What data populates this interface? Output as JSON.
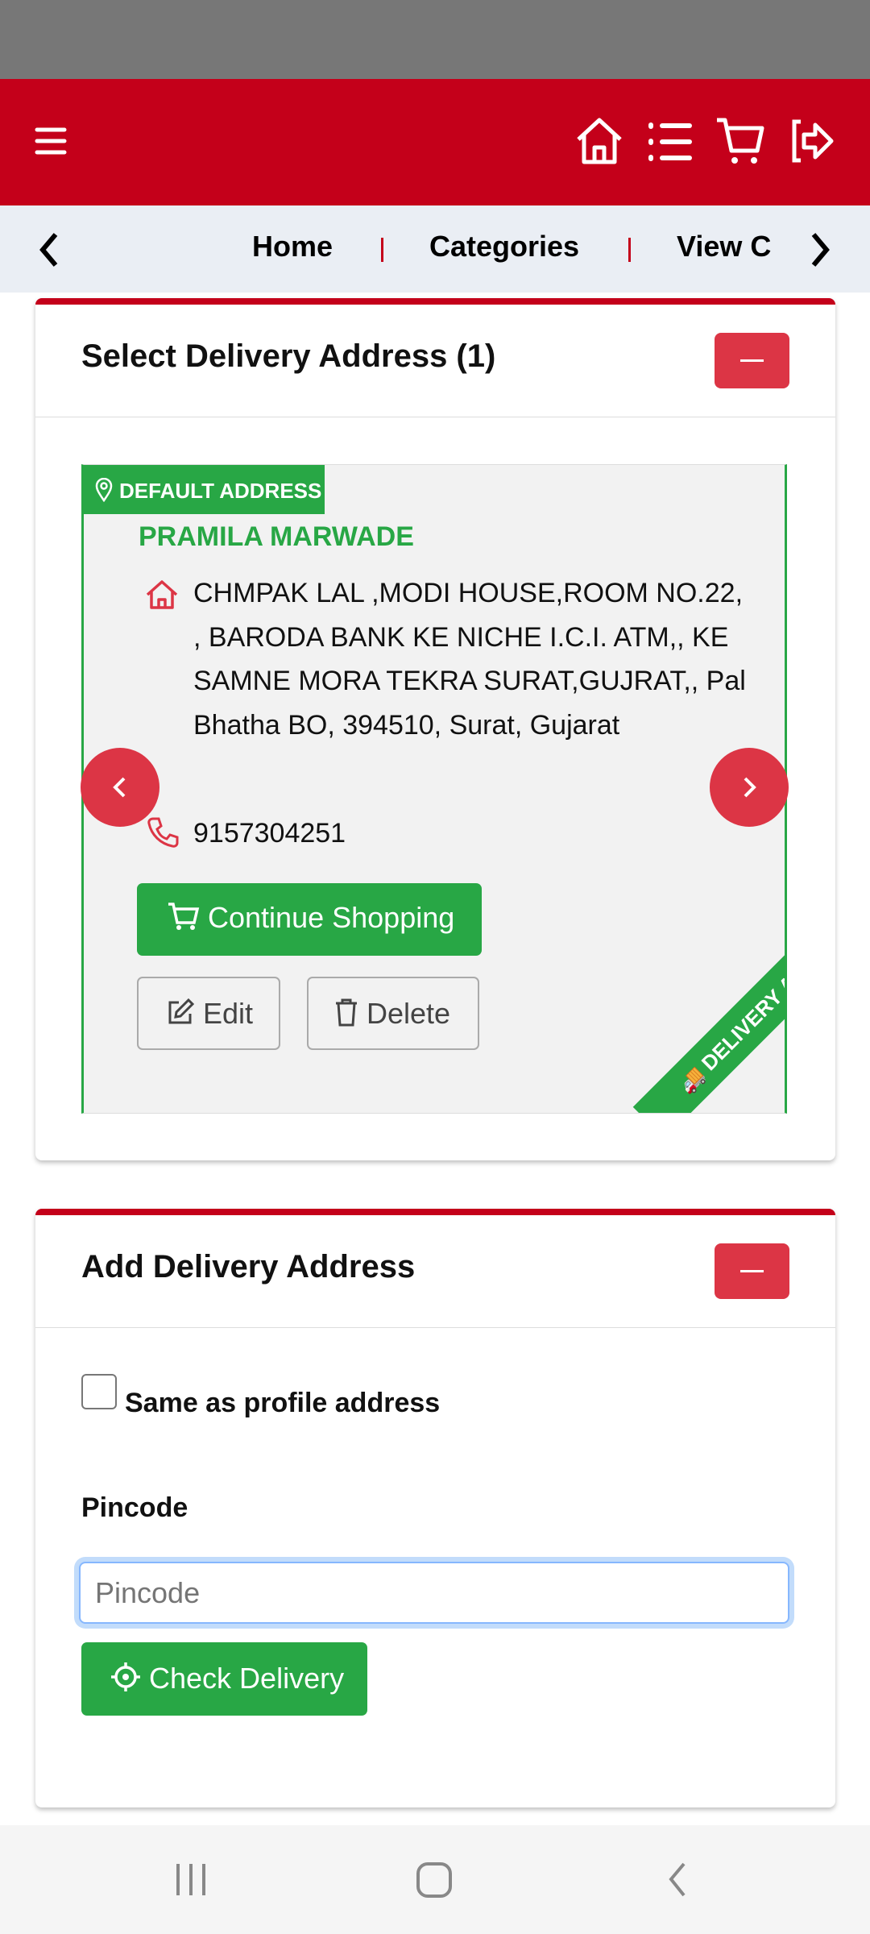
{
  "header": {
    "icons": [
      "menu-icon",
      "home-icon",
      "list-icon",
      "cart-icon",
      "logout-icon"
    ]
  },
  "nav": {
    "links": [
      "Home",
      "Categories",
      "View C"
    ]
  },
  "select_card": {
    "title": "Select Delivery Address (1)",
    "address": {
      "badge": "DEFAULT ADDRESS",
      "name": "PRAMILA MARWADE",
      "text": "CHMPAK LAL ,MODI HOUSE,ROOM NO.22, , BARODA BANK KE NICHE I.C.I. ATM,, KE SAMNE MORA TEKRA SURAT,GUJRAT,, Pal Bhatha BO, 394510, Surat, Gujarat",
      "phone": "9157304251",
      "ribbon": "DELIVERY ADDRESS"
    },
    "continue_label": "Continue Shopping",
    "edit_label": "Edit",
    "delete_label": "Delete"
  },
  "add_card": {
    "title": "Add Delivery Address",
    "same_as_profile_label": "Same as profile address",
    "same_as_profile_checked": false,
    "pincode_label": "Pincode",
    "pincode_placeholder": "Pincode",
    "pincode_value": "",
    "check_label": "Check Delivery"
  },
  "colors": {
    "brand_red": "#c4001a",
    "green": "#28a745",
    "danger": "#dc3545"
  }
}
